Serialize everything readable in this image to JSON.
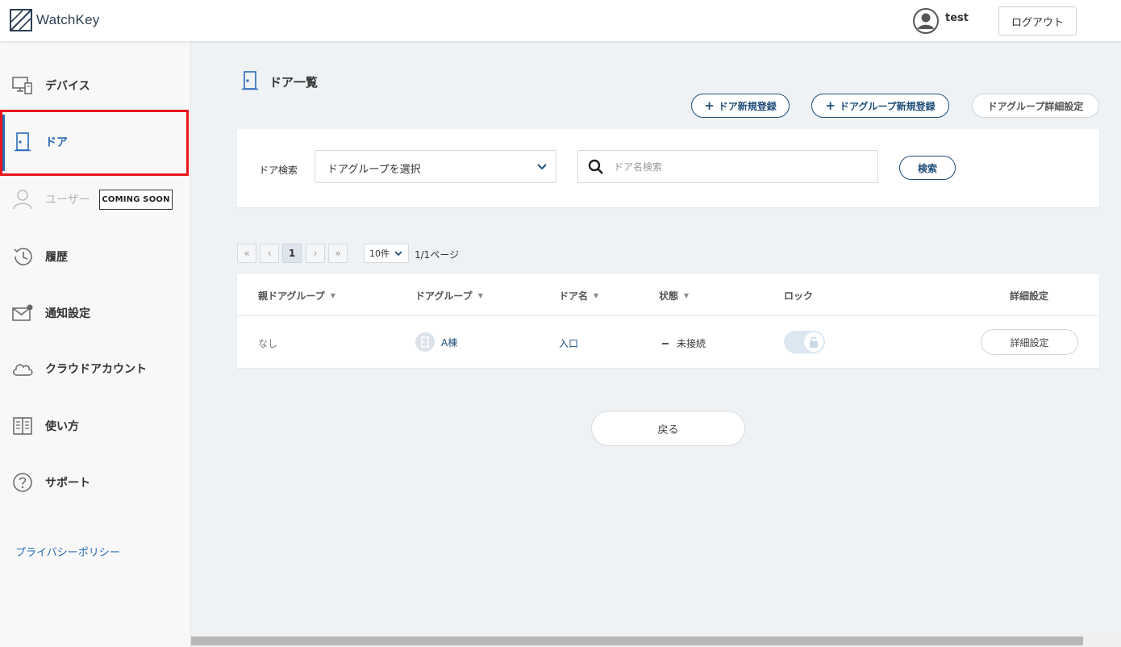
{
  "app": {
    "logo_text": "WatchKey"
  },
  "header": {
    "user_name": "test",
    "logout_label": "ログアウト"
  },
  "sidebar": {
    "items": [
      {
        "label": "デバイス",
        "icon": "monitor-icon"
      },
      {
        "label": "ドア",
        "icon": "door-icon",
        "active": true
      },
      {
        "label": "ユーザー",
        "icon": "user-icon",
        "disabled": true,
        "badge": "COMING SOON"
      },
      {
        "label": "履歴",
        "icon": "history-icon"
      },
      {
        "label": "通知設定",
        "icon": "mail-icon"
      },
      {
        "label": "クラウドアカウント",
        "icon": "cloud-icon"
      },
      {
        "label": "使い方",
        "icon": "book-icon"
      },
      {
        "label": "サポート",
        "icon": "question-icon"
      }
    ],
    "privacy_link": "プライバシーポリシー"
  },
  "page": {
    "title": "ドア一覧",
    "actions": {
      "new_door": "ドア新規登録",
      "new_group": "ドアグループ新規登録",
      "group_settings": "ドアグループ詳細設定"
    }
  },
  "search": {
    "label": "ドア検索",
    "group_select_value": "ドアグループを選択",
    "name_placeholder": "ドア名検索",
    "name_value": "",
    "button": "検索"
  },
  "pagination": {
    "first": "«",
    "prev": "‹",
    "current": "1",
    "next": "›",
    "last": "»",
    "per_page": "10件",
    "page_info": "1/1ページ"
  },
  "table": {
    "columns": [
      {
        "label": "親ドアグループ",
        "sortable": true
      },
      {
        "label": "ドアグループ",
        "sortable": true
      },
      {
        "label": "ドア名",
        "sortable": true
      },
      {
        "label": "状態",
        "sortable": true
      },
      {
        "label": "ロック",
        "sortable": false
      },
      {
        "label": "詳細設定",
        "sortable": false
      }
    ],
    "rows": [
      {
        "parent_group": "なし",
        "group": "A棟",
        "door_name": "入口",
        "status": "未接続",
        "lock_state": "unlocked",
        "detail_button": "詳細設定"
      }
    ]
  },
  "footer": {
    "back_button": "戻る"
  },
  "colors": {
    "accent": "#2a6ab8",
    "primary_border": "#1f4e79",
    "highlight": "#e8161c"
  }
}
